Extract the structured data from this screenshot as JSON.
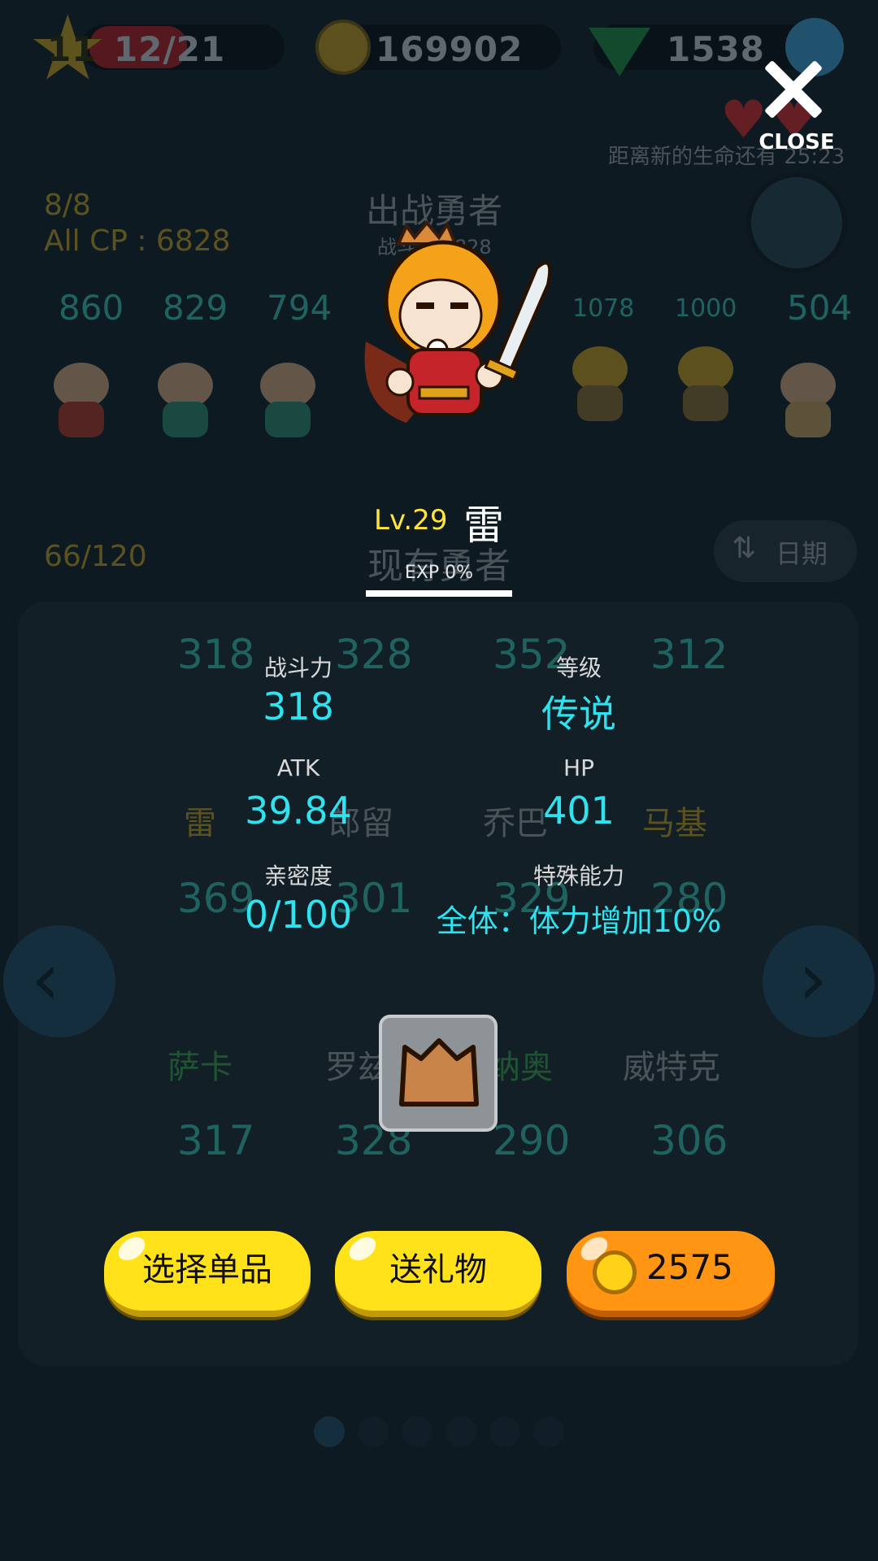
{
  "topbar": {
    "level": "11",
    "stamina": "12/21",
    "coins": "169902",
    "gems": "1538",
    "life_timer": "距离新的生命还有 25:23"
  },
  "background": {
    "team_count": "8/8",
    "all_cp": "All CP : 6828",
    "team_title": "出战勇者",
    "team_subtitle": "战斗力 6828",
    "team_cp": [
      "860",
      "829",
      "794",
      "",
      "1078",
      "1000",
      "504"
    ],
    "hero_count": "66/120",
    "heroes_title": "现有勇者",
    "sort_label": "日期",
    "grid_cp_row1": [
      "318",
      "328",
      "352",
      "312"
    ],
    "grid_names_row1": [
      "雷",
      "郎留",
      "乔巴",
      "马基"
    ],
    "grid_cp_row2": [
      "369",
      "301",
      "329",
      "280"
    ],
    "grid_names_row2": [
      "萨卡",
      "罗兹",
      "纳奥",
      "威特克"
    ],
    "grid_cp_row3": [
      "317",
      "328",
      "290",
      "306"
    ]
  },
  "overlay": {
    "close_label": "CLOSE",
    "hero_level": "Lv.29",
    "hero_name": "雷",
    "exp_label": "EXP 0%",
    "stats": {
      "power_label": "战斗力",
      "power_value": "318",
      "grade_label": "等级",
      "grade_value": "传说",
      "atk_label": "ATK",
      "atk_value": "39.84",
      "hp_label": "HP",
      "hp_value": "401",
      "affinity_label": "亲密度",
      "affinity_value": "0/100",
      "skill_label": "特殊能力",
      "skill_value": "全体：体力增加10%"
    },
    "buttons": {
      "select_item": "选择单品",
      "send_gift": "送礼物",
      "price": "2575"
    }
  },
  "colors": {
    "accent_cyan": "#2ee3ef",
    "level_yellow": "#ffe43a",
    "button_yellow": "#ffe21a",
    "button_orange": "#ff9512"
  }
}
